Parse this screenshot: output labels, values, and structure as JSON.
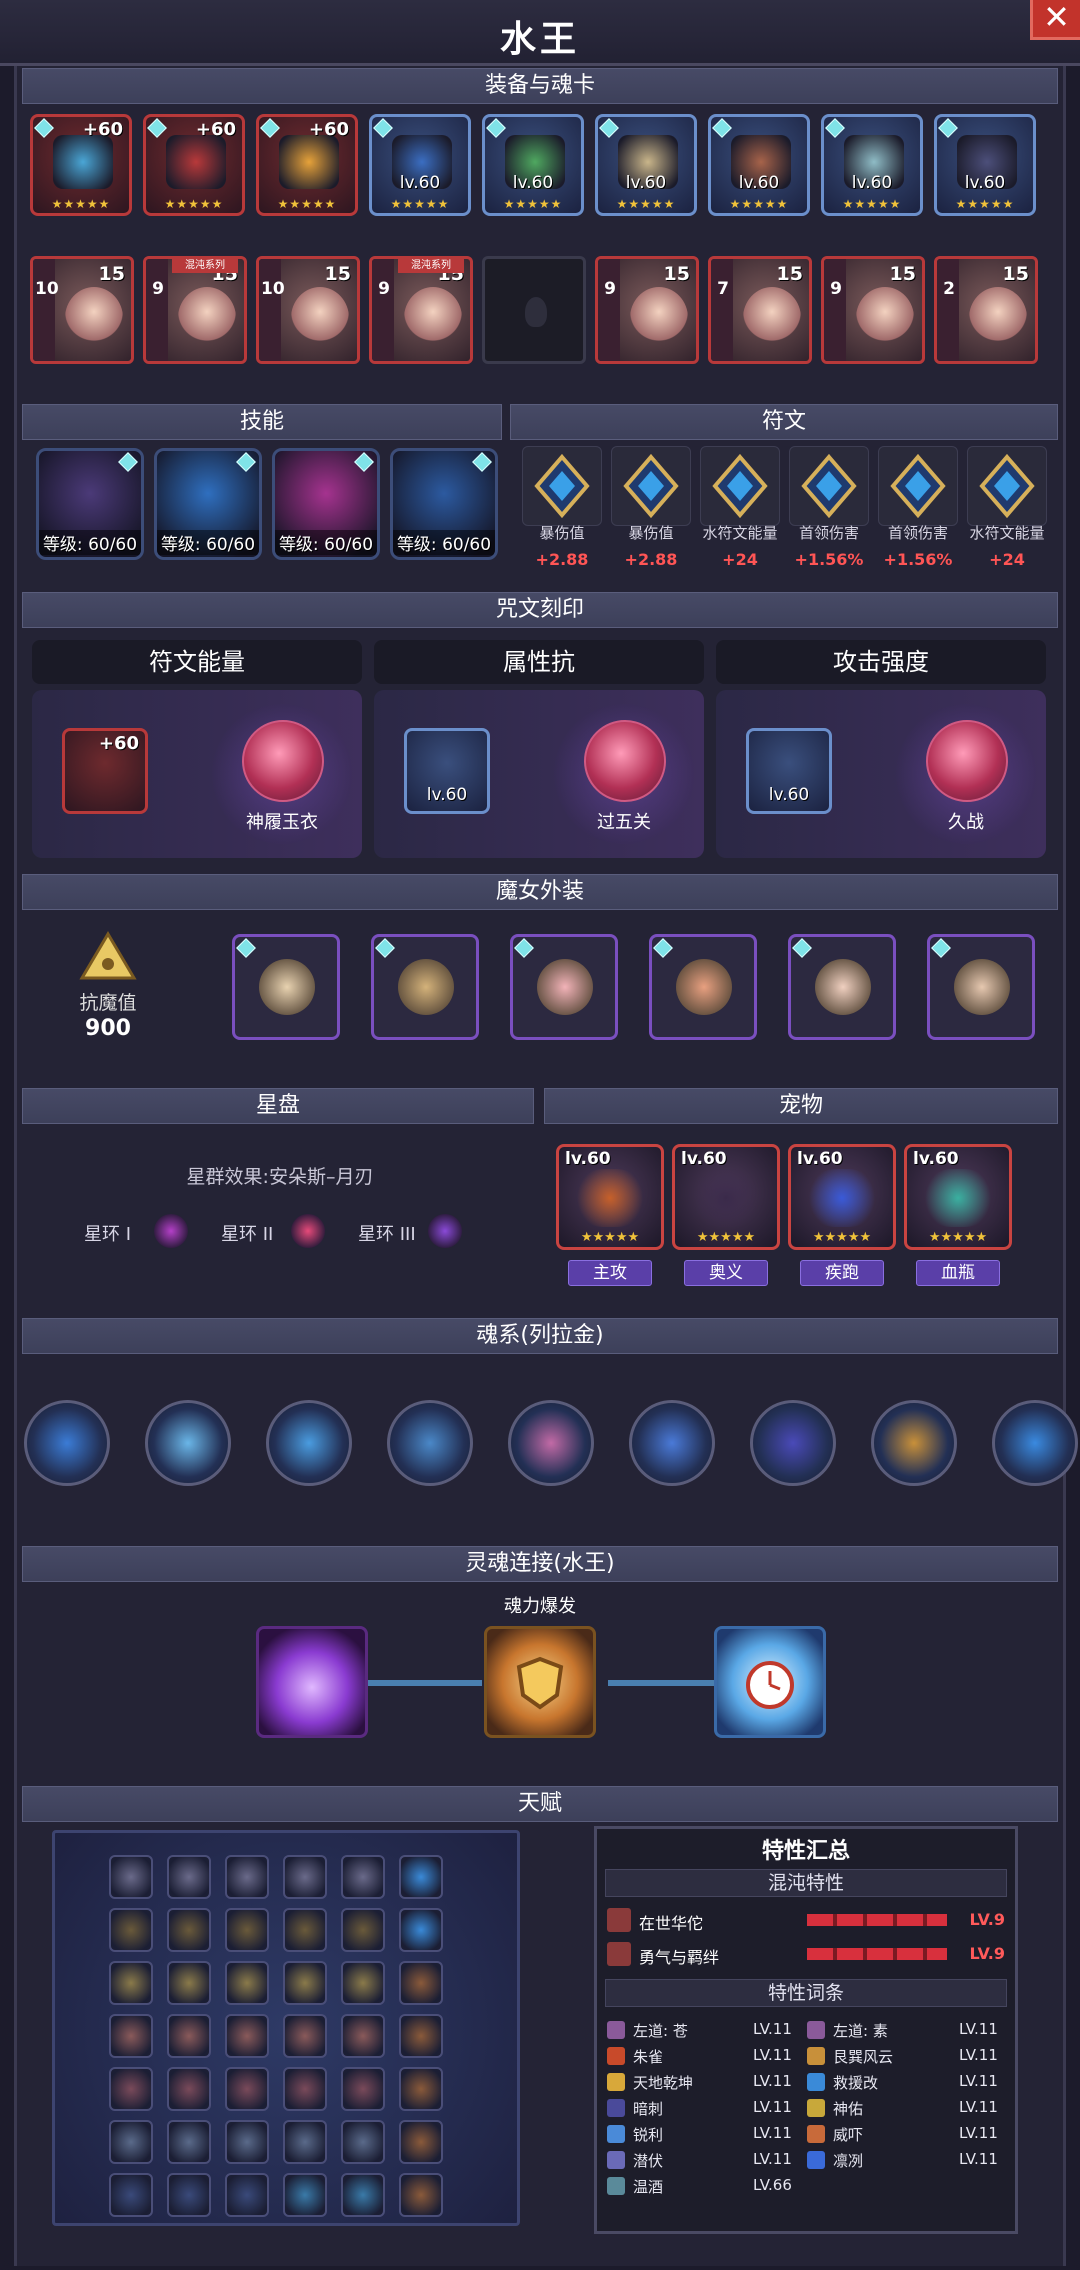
{
  "window": {
    "title": "水王",
    "close": "✕"
  },
  "sections": {
    "equipment": "装备与魂卡",
    "skills": "技能",
    "runes": "符文",
    "imprint": "咒文刻印",
    "outfit": "魔女外装",
    "star": "星盘",
    "pets": "宠物",
    "soul": "魂系(列拉金)",
    "link": "灵魂连接(水王)",
    "talent": "天赋"
  },
  "equipment": {
    "gear": [
      {
        "label": "+60",
        "stars": "★★★★★",
        "color": "#4aa6d6"
      },
      {
        "label": "+60",
        "stars": "★★★★★",
        "color": "#b8393a"
      },
      {
        "label": "+60",
        "stars": "★★★★★",
        "color": "#e6a23a"
      },
      {
        "label": "lv.60",
        "stars": "★★★★★",
        "color": "#3b6ec2"
      },
      {
        "label": "lv.60",
        "stars": "★★★★★",
        "color": "#4fa860"
      },
      {
        "label": "lv.60",
        "stars": "★★★★★",
        "color": "#c9b58a"
      },
      {
        "label": "lv.60",
        "stars": "★★★★★",
        "color": "#a7634a"
      },
      {
        "label": "lv.60",
        "stars": "★★★★★",
        "color": "#8fbcc6"
      },
      {
        "label": "lv.60",
        "stars": "★★★★★",
        "color": "#4c4f7a"
      }
    ],
    "cards": [
      {
        "side": "10",
        "num": "15",
        "tag": ""
      },
      {
        "side": "9",
        "num": "15",
        "tag": "混沌系列"
      },
      {
        "side": "10",
        "num": "15",
        "tag": ""
      },
      {
        "side": "9",
        "num": "15",
        "tag": "混沌系列"
      },
      {
        "side": "",
        "num": "",
        "tag": "",
        "empty": true
      },
      {
        "side": "9",
        "num": "15",
        "tag": ""
      },
      {
        "side": "7",
        "num": "15",
        "tag": ""
      },
      {
        "side": "9",
        "num": "15",
        "tag": ""
      },
      {
        "side": "2",
        "num": "15",
        "tag": ""
      }
    ]
  },
  "skills": [
    {
      "level": "等级: 60/60",
      "color": "#4b3a78"
    },
    {
      "level": "等级: 60/60",
      "color": "#2f6fbf"
    },
    {
      "level": "等级: 60/60",
      "color": "#a5338f"
    },
    {
      "level": "等级: 60/60",
      "color": "#2c5aa0"
    }
  ],
  "runes": [
    {
      "name": "暴伤值",
      "value": "+2.88"
    },
    {
      "name": "暴伤值",
      "value": "+2.88"
    },
    {
      "name": "水符文能量",
      "value": "+24"
    },
    {
      "name": "首领伤害",
      "value": "+1.56%"
    },
    {
      "name": "首领伤害",
      "value": "+1.56%"
    },
    {
      "name": "水符文能量",
      "value": "+24"
    }
  ],
  "imprint": {
    "columns": [
      {
        "header": "符文能量",
        "item": "+60",
        "item_lv": "",
        "crystal": "神履玉衣"
      },
      {
        "header": "属性抗",
        "item": "",
        "item_lv": "lv.60",
        "crystal": "过五关"
      },
      {
        "header": "攻击强度",
        "item": "",
        "item_lv": "lv.60",
        "crystal": "久战"
      }
    ]
  },
  "outfit": {
    "resist_label": "抗魔值",
    "resist_value": "900",
    "items": [
      "horns",
      "brooch",
      "heart",
      "ring",
      "cross",
      "pouch"
    ]
  },
  "star": {
    "effect": "星群效果:安朵斯–月刃",
    "rings": [
      "星环 I",
      "星环 II",
      "星环 III"
    ]
  },
  "pets": [
    {
      "lv": "lv.60",
      "tag": "主攻",
      "stars": "★★★★★"
    },
    {
      "lv": "lv.60",
      "tag": "奥义",
      "stars": "★★★★★"
    },
    {
      "lv": "lv.60",
      "tag": "疾跑",
      "stars": "★★★★★"
    },
    {
      "lv": "lv.60",
      "tag": "血瓶",
      "stars": "★★★★★"
    }
  ],
  "soul": {
    "nodes": [
      "sword",
      "shell",
      "axe",
      "trident",
      "rose",
      "blade",
      "moon",
      "fist",
      "cannon"
    ]
  },
  "link": {
    "caption": "魂力爆发"
  },
  "traits": {
    "title": "特性汇总",
    "chaos_header": "混沌特性",
    "chaos": [
      {
        "name": "在世华佗",
        "level": "LV.9"
      },
      {
        "name": "勇气与羁绊",
        "level": "LV.9"
      }
    ],
    "words_header": "特性词条",
    "words_left": [
      {
        "name": "左道: 苍",
        "level": "LV.11"
      },
      {
        "name": "朱雀",
        "level": "LV.11"
      },
      {
        "name": "天地乾坤",
        "level": "LV.11"
      },
      {
        "name": "暗刺",
        "level": "LV.11"
      },
      {
        "name": "锐利",
        "level": "LV.11"
      },
      {
        "name": "潜伏",
        "level": "LV.11"
      },
      {
        "name": "温酒",
        "level": "LV.66"
      }
    ],
    "words_right": [
      {
        "name": "左道: 素",
        "level": "LV.11"
      },
      {
        "name": "艮巽风云",
        "level": "LV.11"
      },
      {
        "name": "救援改",
        "level": "LV.11"
      },
      {
        "name": "神佑",
        "level": "LV.11"
      },
      {
        "name": "威吓",
        "level": "LV.11"
      },
      {
        "name": "凛冽",
        "level": "LV.11"
      }
    ]
  }
}
